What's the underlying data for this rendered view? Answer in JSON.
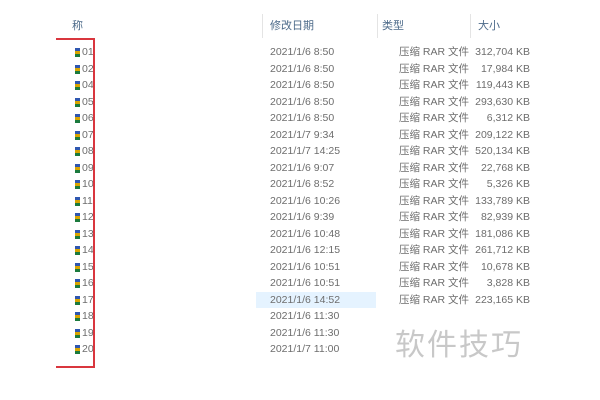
{
  "columns": [
    {
      "label": "称"
    },
    {
      "label": "修改日期"
    },
    {
      "label": "类型"
    },
    {
      "label": "大小"
    }
  ],
  "files": [
    {
      "name": "01",
      "date": "2021/1/6 8:50",
      "type": "压缩 RAR 文件",
      "size": "312,704 KB"
    },
    {
      "name": "02",
      "date": "2021/1/6 8:50",
      "type": "压缩 RAR 文件",
      "size": "17,984 KB"
    },
    {
      "name": "04",
      "date": "2021/1/6 8:50",
      "type": "压缩 RAR 文件",
      "size": "119,443 KB"
    },
    {
      "name": "05",
      "date": "2021/1/6 8:50",
      "type": "压缩 RAR 文件",
      "size": "293,630 KB"
    },
    {
      "name": "06",
      "date": "2021/1/6 8:50",
      "type": "压缩 RAR 文件",
      "size": "6,312 KB"
    },
    {
      "name": "07",
      "date": "2021/1/7 9:34",
      "type": "压缩 RAR 文件",
      "size": "209,122 KB"
    },
    {
      "name": "08",
      "date": "2021/1/7 14:25",
      "type": "压缩 RAR 文件",
      "size": "520,134 KB"
    },
    {
      "name": "09",
      "date": "2021/1/6 9:07",
      "type": "压缩 RAR 文件",
      "size": "22,768 KB"
    },
    {
      "name": "10",
      "date": "2021/1/6 8:52",
      "type": "压缩 RAR 文件",
      "size": "5,326 KB"
    },
    {
      "name": "11",
      "date": "2021/1/6 10:26",
      "type": "压缩 RAR 文件",
      "size": "133,789 KB"
    },
    {
      "name": "12",
      "date": "2021/1/6 9:39",
      "type": "压缩 RAR 文件",
      "size": "82,939 KB"
    },
    {
      "name": "13",
      "date": "2021/1/6 10:48",
      "type": "压缩 RAR 文件",
      "size": "181,086 KB"
    },
    {
      "name": "14",
      "date": "2021/1/6 12:15",
      "type": "压缩 RAR 文件",
      "size": "261,712 KB"
    },
    {
      "name": "15",
      "date": "2021/1/6 10:51",
      "type": "压缩 RAR 文件",
      "size": "10,678 KB"
    },
    {
      "name": "16",
      "date": "2021/1/6 10:51",
      "type": "压缩 RAR 文件",
      "size": "3,828 KB"
    },
    {
      "name": "17",
      "date": "2021/1/6 14:52",
      "type": "压缩 RAR 文件",
      "size": "223,165 KB"
    },
    {
      "name": "18",
      "date": "2021/1/6 11:30",
      "type": "",
      "size": ""
    },
    {
      "name": "19",
      "date": "2021/1/6 11:30",
      "type": "",
      "size": ""
    },
    {
      "name": "20",
      "date": "2021/1/7 11:00",
      "type": "",
      "size": ""
    }
  ],
  "watermark": "软件技巧",
  "colors": {
    "highlight": "#e5f3ff",
    "annotation_frame": "#d9363e",
    "header_text": "#4d6b8a"
  },
  "icons": {
    "file": "rar-archive-icon"
  }
}
